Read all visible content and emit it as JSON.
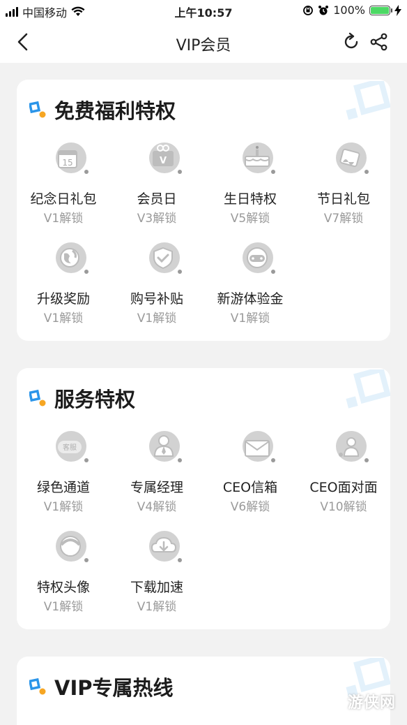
{
  "status_bar": {
    "carrier": "中国移动",
    "time": "上午10:57",
    "battery": "100%",
    "battery_level": 1.0
  },
  "nav": {
    "title": "VIP会员",
    "back_icon": "chevron-left-icon",
    "refresh_icon": "refresh-icon",
    "share_icon": "share-icon"
  },
  "sections": [
    {
      "title": "免费福利特权",
      "items": [
        {
          "name": "纪念日礼包",
          "unlock": "V1解锁",
          "icon": "calendar-icon"
        },
        {
          "name": "会员日",
          "unlock": "V3解锁",
          "icon": "vip-gift-icon"
        },
        {
          "name": "生日特权",
          "unlock": "V5解锁",
          "icon": "birthday-cake-icon"
        },
        {
          "name": "节日礼包",
          "unlock": "V7解锁",
          "icon": "festival-gift-icon"
        },
        {
          "name": "升级奖励",
          "unlock": "V1解锁",
          "icon": "globe-icon"
        },
        {
          "name": "购号补贴",
          "unlock": "V1解锁",
          "icon": "shield-check-icon"
        },
        {
          "name": "新游体验金",
          "unlock": "V1解锁",
          "icon": "gamepad-icon"
        }
      ]
    },
    {
      "title": "服务特权",
      "items": [
        {
          "name": "绿色通道",
          "unlock": "V1解锁",
          "icon": "customer-service-icon",
          "badge": "客服"
        },
        {
          "name": "专属经理",
          "unlock": "V4解锁",
          "icon": "manager-icon"
        },
        {
          "name": "CEO信箱",
          "unlock": "V6解锁",
          "icon": "mail-icon"
        },
        {
          "name": "CEO面对面",
          "unlock": "V10解锁",
          "icon": "meeting-icon"
        },
        {
          "name": "特权头像",
          "unlock": "V1解锁",
          "icon": "avatar-frame-icon"
        },
        {
          "name": "下载加速",
          "unlock": "V1解锁",
          "icon": "download-cloud-icon"
        }
      ]
    },
    {
      "title": "VIP专属热线",
      "items": []
    }
  ],
  "watermark": "游侠网"
}
